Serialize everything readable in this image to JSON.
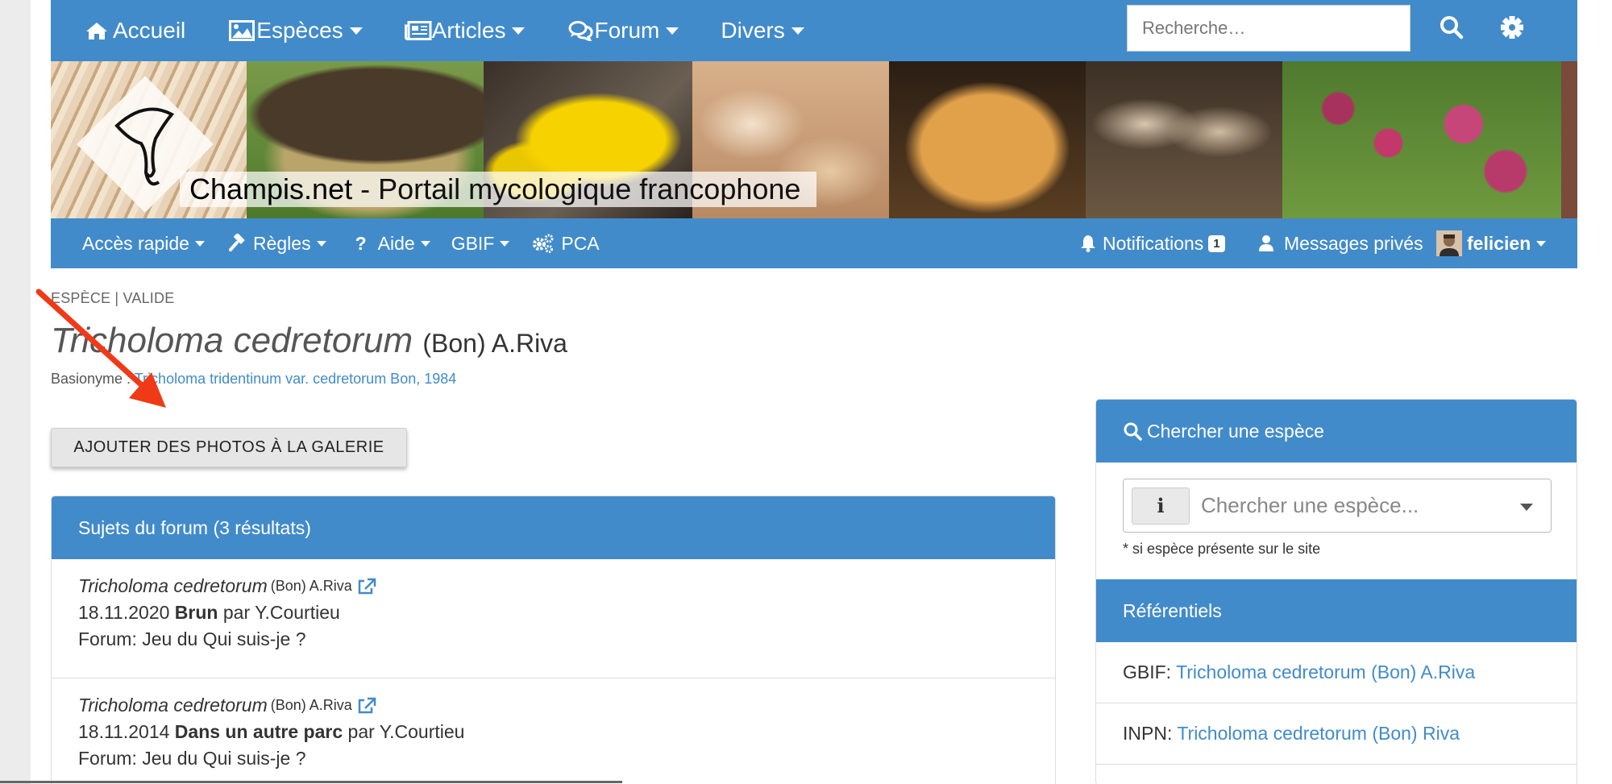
{
  "topnav": {
    "items": [
      {
        "label": "Accueil",
        "icon": "home-icon",
        "caret": false
      },
      {
        "label": "Espèces",
        "icon": "image-icon",
        "caret": true
      },
      {
        "label": "Articles",
        "icon": "newspaper-icon",
        "caret": true
      },
      {
        "label": "Forum",
        "icon": "comments-icon",
        "caret": true
      },
      {
        "label": "Divers",
        "icon": "",
        "caret": true
      }
    ],
    "search_placeholder": "Recherche…"
  },
  "banner": {
    "site_name": "Champis.net",
    "tagline": " - Portail mycologique francophone"
  },
  "subnav": {
    "items": [
      {
        "label": "Accès rapide"
      },
      {
        "label": "Règles"
      },
      {
        "label": "Aide"
      },
      {
        "label": "GBIF"
      },
      {
        "label": "PCA"
      }
    ],
    "notifications_label": "Notifications",
    "notifications_count": "1",
    "messages_label": "Messages privés",
    "user_label": "felicien"
  },
  "species": {
    "kicker": "ESPÈCE | VALIDE",
    "name": "Tricholoma cedretorum",
    "author": "(Bon) A.Riva",
    "basionym_label": "Basionyme : ",
    "basionym_value": "Tricholoma tridentinum var. cedretorum Bon, 1984"
  },
  "gallery_button": "AJOUTER DES PHOTOS À LA GALERIE",
  "forum": {
    "header": "Sujets du forum (3 résultats)",
    "topics": [
      {
        "name": "Tricholoma cedretorum",
        "author": "(Bon) A.Riva",
        "date": "18.11.2020",
        "title": "Brun",
        "by": "par Y.Courtieu",
        "forum": "Forum: Jeu du Qui suis-je ?"
      },
      {
        "name": "Tricholoma cedretorum",
        "author": "(Bon) A.Riva",
        "date": "18.11.2014",
        "title": "Dans un autre parc",
        "by": "par Y.Courtieu",
        "forum": "Forum: Jeu du Qui suis-je ?"
      }
    ]
  },
  "sidebar": {
    "search_header": "Chercher une espèce",
    "search_placeholder": "Chercher une espèce...",
    "hint": "* si espèce présente sur le site",
    "referentials_header": "Référentiels",
    "refs": [
      {
        "label": "GBIF:",
        "value": "Tricholoma cedretorum (Bon) A.Riva"
      },
      {
        "label": "INPN:",
        "value": "Tricholoma cedretorum (Bon) Riva"
      }
    ]
  },
  "colors": {
    "primary": "#428bca",
    "annotation_arrow": "#f03a17"
  }
}
